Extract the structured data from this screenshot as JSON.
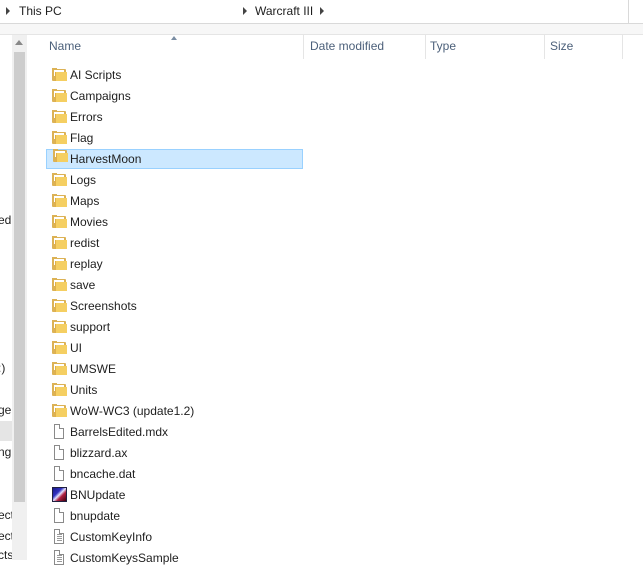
{
  "address": {
    "crumbs": [
      "This PC",
      "Warcraft III"
    ]
  },
  "nav_fragments": [
    "edi",
    ":)",
    "ge",
    "ng",
    "ect",
    "ect",
    "cts"
  ],
  "columns": {
    "name": "Name",
    "date_modified": "Date modified",
    "type": "Type",
    "size": "Size"
  },
  "items": [
    {
      "name": "AI Scripts",
      "kind": "folder"
    },
    {
      "name": "Campaigns",
      "kind": "folder"
    },
    {
      "name": "Errors",
      "kind": "folder"
    },
    {
      "name": "Flag",
      "kind": "folder"
    },
    {
      "name": "HarvestMoon",
      "kind": "folder",
      "selected": true
    },
    {
      "name": "Logs",
      "kind": "folder"
    },
    {
      "name": "Maps",
      "kind": "folder"
    },
    {
      "name": "Movies",
      "kind": "folder"
    },
    {
      "name": "redist",
      "kind": "folder"
    },
    {
      "name": "replay",
      "kind": "folder"
    },
    {
      "name": "save",
      "kind": "folder"
    },
    {
      "name": "Screenshots",
      "kind": "folder"
    },
    {
      "name": "support",
      "kind": "folder"
    },
    {
      "name": "UI",
      "kind": "folder"
    },
    {
      "name": "UMSWE",
      "kind": "folder"
    },
    {
      "name": "Units",
      "kind": "folder"
    },
    {
      "name": "WoW-WC3 (update1.2)",
      "kind": "folder"
    },
    {
      "name": "BarrelsEdited.mdx",
      "kind": "file"
    },
    {
      "name": "blizzard.ax",
      "kind": "file"
    },
    {
      "name": "bncache.dat",
      "kind": "file"
    },
    {
      "name": "BNUpdate",
      "kind": "app"
    },
    {
      "name": "bnupdate",
      "kind": "file"
    },
    {
      "name": "CustomKeyInfo",
      "kind": "text"
    },
    {
      "name": "CustomKeysSample",
      "kind": "text"
    }
  ],
  "colors": {
    "selection_bg": "#cce8ff",
    "selection_border": "#99d1ff",
    "header_text": "#4c607a"
  }
}
